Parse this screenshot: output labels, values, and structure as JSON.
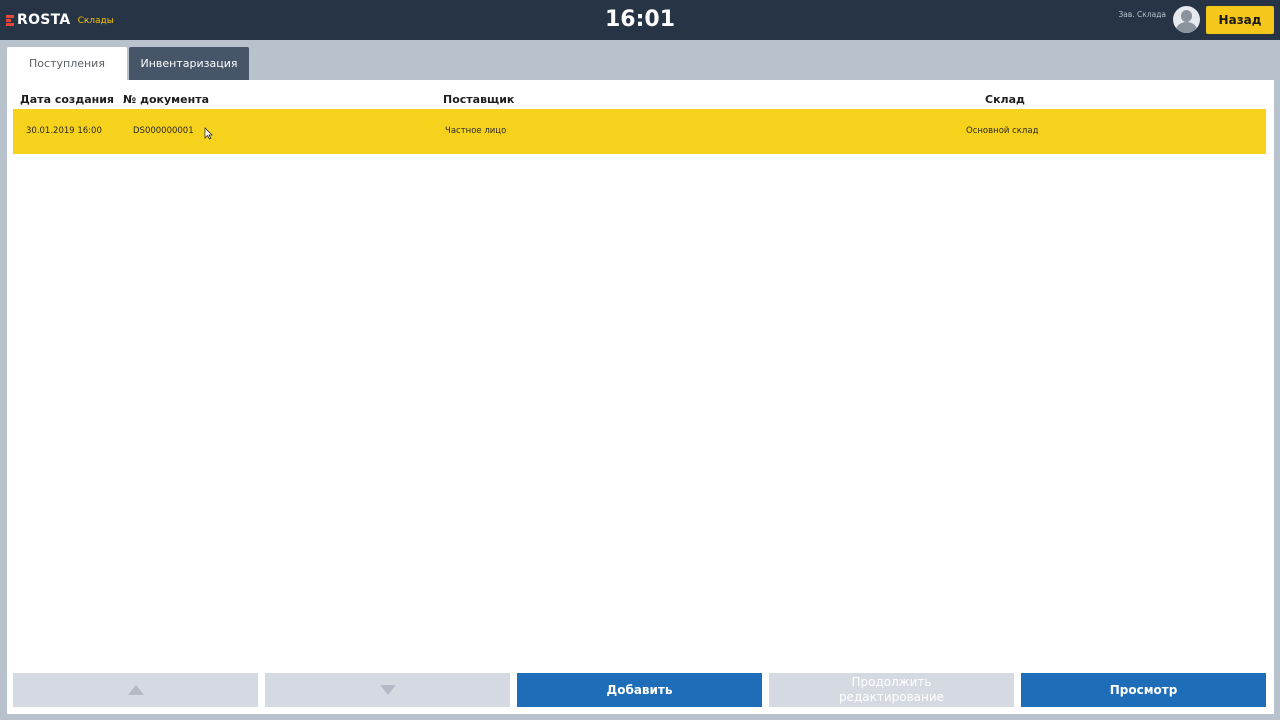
{
  "header": {
    "logo_text": "ROSTA",
    "module": "Склады",
    "clock": "16:01",
    "user_role": "Зав. Склада",
    "back_label": "Назад"
  },
  "tabs": [
    {
      "label": "Поступления",
      "active": true
    },
    {
      "label": "Инвентаризация",
      "active": false
    }
  ],
  "table": {
    "columns": [
      "Дата создания",
      "№ документа",
      "Поставщик",
      "Склад"
    ],
    "rows": [
      {
        "date": "30.01.2019 16:00",
        "doc_no": "DS000000001",
        "supplier": "Частное лицо",
        "warehouse": "Основной склад",
        "selected": true
      }
    ]
  },
  "actions": {
    "add_label": "Добавить",
    "continue_label": "Продолжить редактирование",
    "view_label": "Просмотр"
  },
  "colors": {
    "topbar": "#263445",
    "accent_yellow": "#f5c71a",
    "primary_blue": "#1e6db8",
    "selected_row": "#f7d21c"
  }
}
